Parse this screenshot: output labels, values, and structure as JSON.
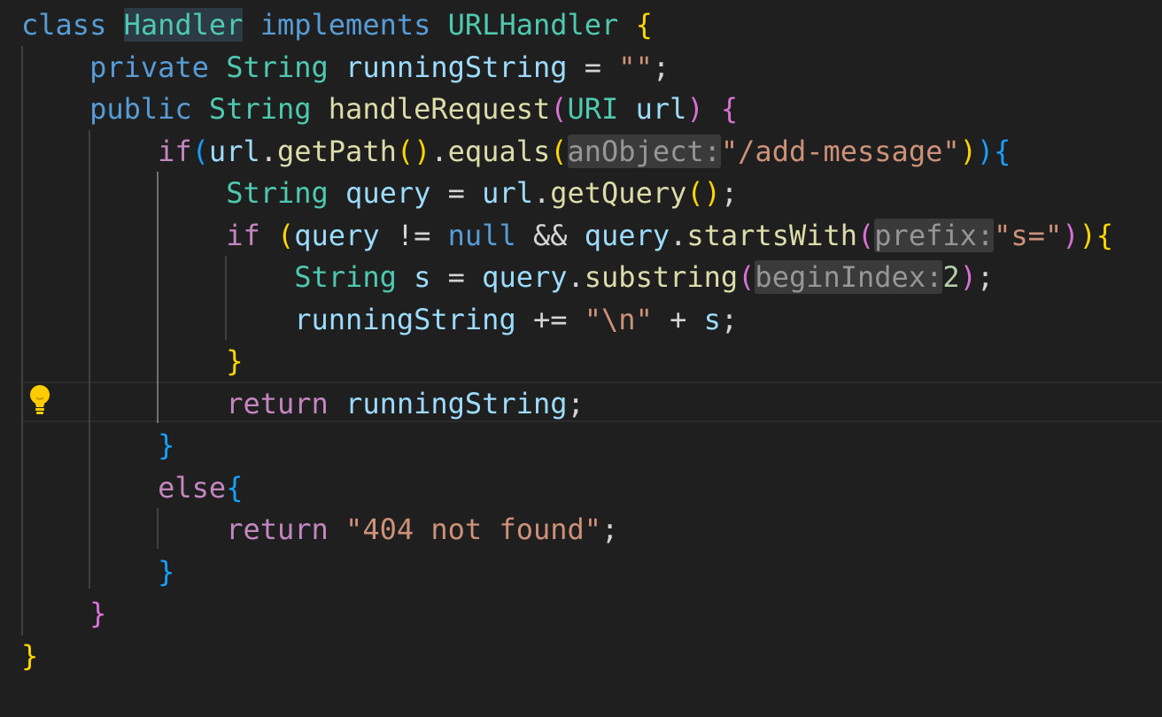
{
  "editor": {
    "language": "java",
    "colors": {
      "background": "#1f1f1f",
      "keyword": "#569cd6",
      "control_keyword": "#c586c0",
      "type": "#4ec9b0",
      "variable": "#9cdcfe",
      "function": "#dcdcaa",
      "string": "#ce9178",
      "number": "#b5cea8",
      "bracket_1": "#ffd700",
      "bracket_2": "#da70d6",
      "bracket_3": "#179fff"
    },
    "lightbulb_icon": "lightbulb-icon",
    "lines": [
      [
        {
          "t": "class",
          "c": "kw-decl"
        },
        {
          "t": " ",
          "c": "op"
        },
        {
          "t": "Handler",
          "c": "cls sel-word"
        },
        {
          "t": " ",
          "c": "op"
        },
        {
          "t": "implements",
          "c": "kw-decl"
        },
        {
          "t": " ",
          "c": "op"
        },
        {
          "t": "URLHandler",
          "c": "cls"
        },
        {
          "t": " ",
          "c": "op"
        },
        {
          "t": "{",
          "c": "b1"
        }
      ],
      [
        {
          "t": "    ",
          "c": "op"
        },
        {
          "t": "private",
          "c": "kw-decl"
        },
        {
          "t": " ",
          "c": "op"
        },
        {
          "t": "String",
          "c": "cls"
        },
        {
          "t": " ",
          "c": "op"
        },
        {
          "t": "runningString",
          "c": "vr"
        },
        {
          "t": " = ",
          "c": "op"
        },
        {
          "t": "\"\"",
          "c": "str"
        },
        {
          "t": ";",
          "c": "op"
        }
      ],
      [
        {
          "t": "    ",
          "c": "op"
        },
        {
          "t": "public",
          "c": "kw-decl"
        },
        {
          "t": " ",
          "c": "op"
        },
        {
          "t": "String",
          "c": "cls"
        },
        {
          "t": " ",
          "c": "op"
        },
        {
          "t": "handleRequest",
          "c": "fn"
        },
        {
          "t": "(",
          "c": "b2"
        },
        {
          "t": "URI",
          "c": "cls"
        },
        {
          "t": " ",
          "c": "op"
        },
        {
          "t": "url",
          "c": "vr"
        },
        {
          "t": ")",
          "c": "b2"
        },
        {
          "t": " ",
          "c": "op"
        },
        {
          "t": "{",
          "c": "b2"
        }
      ],
      [
        {
          "t": "        ",
          "c": "op"
        },
        {
          "t": "if",
          "c": "kw-ctrl"
        },
        {
          "t": "(",
          "c": "b3"
        },
        {
          "t": "url",
          "c": "vr"
        },
        {
          "t": ".",
          "c": "op"
        },
        {
          "t": "getPath",
          "c": "fn"
        },
        {
          "t": "()",
          "c": "b1"
        },
        {
          "t": ".",
          "c": "op"
        },
        {
          "t": "equals",
          "c": "fn"
        },
        {
          "t": "(",
          "c": "b1"
        },
        {
          "t": "anObject:",
          "c": "hint"
        },
        {
          "t": "\"/add-message\"",
          "c": "str"
        },
        {
          "t": ")",
          "c": "b1"
        },
        {
          "t": ")",
          "c": "b3"
        },
        {
          "t": "{",
          "c": "b3"
        }
      ],
      [
        {
          "t": "            ",
          "c": "op"
        },
        {
          "t": "String",
          "c": "cls"
        },
        {
          "t": " ",
          "c": "op"
        },
        {
          "t": "query",
          "c": "vr"
        },
        {
          "t": " = ",
          "c": "op"
        },
        {
          "t": "url",
          "c": "vr"
        },
        {
          "t": ".",
          "c": "op"
        },
        {
          "t": "getQuery",
          "c": "fn"
        },
        {
          "t": "()",
          "c": "b1"
        },
        {
          "t": ";",
          "c": "op"
        }
      ],
      [
        {
          "t": "            ",
          "c": "op"
        },
        {
          "t": "if",
          "c": "kw-ctrl"
        },
        {
          "t": " ",
          "c": "op"
        },
        {
          "t": "(",
          "c": "b1"
        },
        {
          "t": "query",
          "c": "vr"
        },
        {
          "t": " != ",
          "c": "op"
        },
        {
          "t": "null",
          "c": "kw-decl"
        },
        {
          "t": " && ",
          "c": "op"
        },
        {
          "t": "query",
          "c": "vr"
        },
        {
          "t": ".",
          "c": "op"
        },
        {
          "t": "startsWith",
          "c": "fn"
        },
        {
          "t": "(",
          "c": "b2"
        },
        {
          "t": "prefix:",
          "c": "hint"
        },
        {
          "t": "\"s=\"",
          "c": "str"
        },
        {
          "t": ")",
          "c": "b2"
        },
        {
          "t": ")",
          "c": "b1"
        },
        {
          "t": "{",
          "c": "b1"
        }
      ],
      [
        {
          "t": "                ",
          "c": "op"
        },
        {
          "t": "String",
          "c": "cls"
        },
        {
          "t": " ",
          "c": "op"
        },
        {
          "t": "s",
          "c": "vr"
        },
        {
          "t": " = ",
          "c": "op"
        },
        {
          "t": "query",
          "c": "vr"
        },
        {
          "t": ".",
          "c": "op"
        },
        {
          "t": "substring",
          "c": "fn"
        },
        {
          "t": "(",
          "c": "b2"
        },
        {
          "t": "beginIndex:",
          "c": "hint"
        },
        {
          "t": "2",
          "c": "num"
        },
        {
          "t": ")",
          "c": "b2"
        },
        {
          "t": ";",
          "c": "op"
        }
      ],
      [
        {
          "t": "                ",
          "c": "op"
        },
        {
          "t": "runningString",
          "c": "vr"
        },
        {
          "t": " += ",
          "c": "op"
        },
        {
          "t": "\"\\n\"",
          "c": "str"
        },
        {
          "t": " + ",
          "c": "op"
        },
        {
          "t": "s",
          "c": "vr"
        },
        {
          "t": ";",
          "c": "op"
        }
      ],
      [
        {
          "t": "            ",
          "c": "op"
        },
        {
          "t": "}",
          "c": "b1"
        }
      ],
      [
        {
          "t": "            ",
          "c": "op"
        },
        {
          "t": "return",
          "c": "kw-ctrl"
        },
        {
          "t": " ",
          "c": "op"
        },
        {
          "t": "runningString",
          "c": "vr"
        },
        {
          "t": ";",
          "c": "op"
        }
      ],
      [
        {
          "t": "        ",
          "c": "op"
        },
        {
          "t": "}",
          "c": "b3"
        }
      ],
      [
        {
          "t": "        ",
          "c": "op"
        },
        {
          "t": "else",
          "c": "kw-ctrl"
        },
        {
          "t": "{",
          "c": "b3"
        }
      ],
      [
        {
          "t": "            ",
          "c": "op"
        },
        {
          "t": "return",
          "c": "kw-ctrl"
        },
        {
          "t": " ",
          "c": "op"
        },
        {
          "t": "\"404 not found\"",
          "c": "str"
        },
        {
          "t": ";",
          "c": "op"
        }
      ],
      [
        {
          "t": "        ",
          "c": "op"
        },
        {
          "t": "}",
          "c": "b3"
        }
      ],
      [
        {
          "t": "    ",
          "c": "op"
        },
        {
          "t": "}",
          "c": "b2"
        }
      ],
      [
        {
          "t": "}",
          "c": "b1"
        }
      ]
    ]
  }
}
